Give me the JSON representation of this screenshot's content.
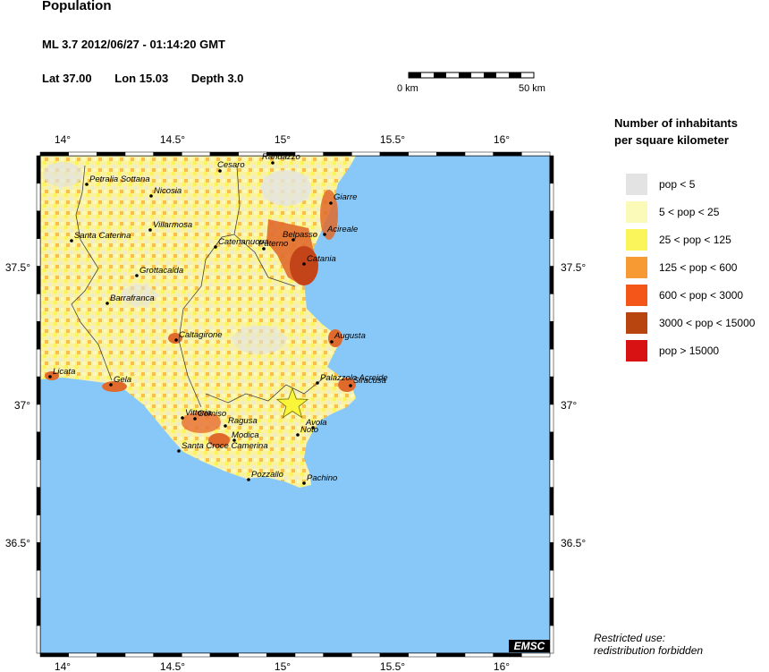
{
  "header": {
    "title": "Population",
    "event_line": "ML 3.7  2012/06/27 - 01:14:20 GMT",
    "lat_label": "Lat 37.00",
    "lon_label": "Lon  15.03",
    "depth_label": "Depth  3.0"
  },
  "scale_bar": {
    "start_label": "0 km",
    "end_label": "50 km"
  },
  "map": {
    "lon_ticks": [
      "14°",
      "14.5°",
      "15°",
      "15.5°",
      "16°"
    ],
    "lat_ticks": [
      "37.5°",
      "37°",
      "36.5°"
    ],
    "colors": {
      "sea": "#87c8f8",
      "land_low": "#fbfab4",
      "land_mid": "#f5e24f",
      "urban": "#e8743a",
      "dense": "#c4441a"
    },
    "epicenter": {
      "lat": 37.0,
      "lon": 15.03
    },
    "cities": [
      {
        "name": "Randazzo"
      },
      {
        "name": "Cesaro"
      },
      {
        "name": "Petralia Sottana"
      },
      {
        "name": "Nicosia"
      },
      {
        "name": "Giarre"
      },
      {
        "name": "Villarmosa"
      },
      {
        "name": "Belpasso"
      },
      {
        "name": "Acireale"
      },
      {
        "name": "Santa Caterina"
      },
      {
        "name": "Catenanuova"
      },
      {
        "name": "Paterno"
      },
      {
        "name": "Catania"
      },
      {
        "name": "Grottacalda"
      },
      {
        "name": "Barrafranca"
      },
      {
        "name": "Caltagirone"
      },
      {
        "name": "Augusta"
      },
      {
        "name": "Licata"
      },
      {
        "name": "Gela"
      },
      {
        "name": "Palazzolo Acreide"
      },
      {
        "name": "Siracusa"
      },
      {
        "name": "Vittoria"
      },
      {
        "name": "Comiso"
      },
      {
        "name": "Ragusa"
      },
      {
        "name": "Avola"
      },
      {
        "name": "Noto"
      },
      {
        "name": "Modica"
      },
      {
        "name": "Santa Croce Camerina"
      },
      {
        "name": "Pozzallo"
      },
      {
        "name": "Pachino"
      }
    ]
  },
  "legend": {
    "title_line1": "Number of inhabitants",
    "title_line2": "per square kilometer",
    "items": [
      {
        "label": "pop < 5",
        "color": "#e3e3e3"
      },
      {
        "label": "5 < pop < 25",
        "color": "#fbfab9"
      },
      {
        "label": "25 < pop < 125",
        "color": "#fbf55c"
      },
      {
        "label": "125 < pop < 600",
        "color": "#f89a34"
      },
      {
        "label": "600 < pop < 3000",
        "color": "#f45518"
      },
      {
        "label": "3000 < pop < 15000",
        "color": "#b8440f"
      },
      {
        "label": "pop > 15000",
        "color": "#d81212"
      }
    ]
  },
  "footer": {
    "restricted_line1": "Restricted use:",
    "restricted_line2": "redistribution forbidden",
    "logo": "EMSC"
  }
}
